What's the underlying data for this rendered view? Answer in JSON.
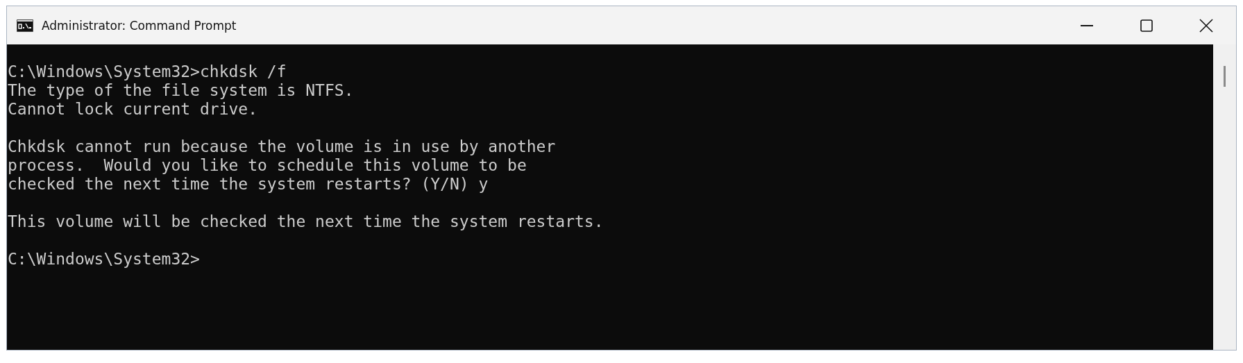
{
  "window": {
    "title": "Administrator: Command Prompt"
  },
  "console": {
    "blocks": [
      [
        "C:\\Windows\\System32>chkdsk /f",
        "The type of the file system is NTFS.",
        "Cannot lock current drive."
      ],
      [
        "Chkdsk cannot run because the volume is in use by another",
        "process.  Would you like to schedule this volume to be",
        "checked the next time the system restarts? (Y/N) y"
      ],
      [
        "This volume will be checked the next time the system restarts."
      ],
      [
        "C:\\Windows\\System32>"
      ]
    ]
  }
}
